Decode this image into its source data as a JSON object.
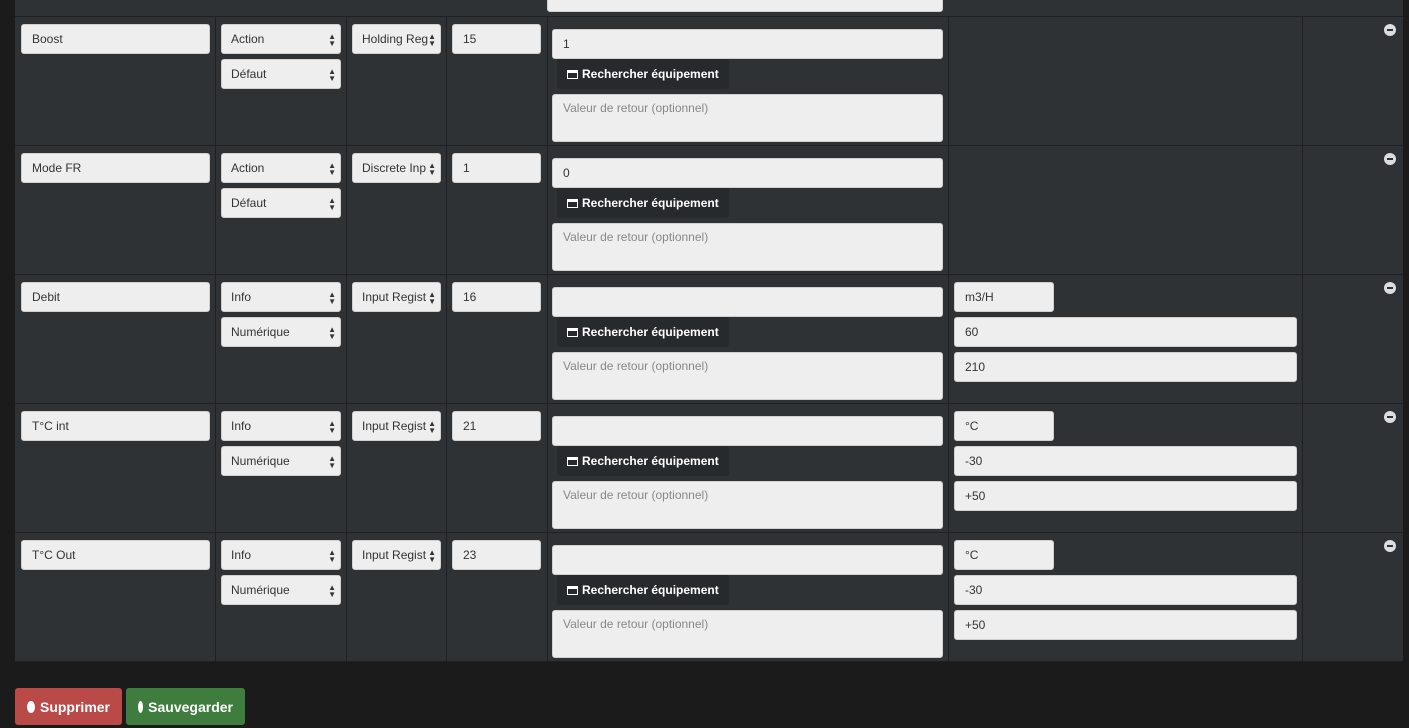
{
  "search_button_label": "Rechercher équipement",
  "return_placeholder": "Valeur de retour (optionnel)",
  "rows": [
    {
      "name": "Boost",
      "type": "Action",
      "subtype": "Défaut",
      "register": "Holding Reg",
      "address": "15",
      "value": "1",
      "unit": "",
      "min": "",
      "max": ""
    },
    {
      "name": "Mode FR",
      "type": "Action",
      "subtype": "Défaut",
      "register": "Discrete Inp",
      "address": "1",
      "value": "0",
      "unit": "",
      "min": "",
      "max": ""
    },
    {
      "name": "Debit",
      "type": "Info",
      "subtype": "Numérique",
      "register": "Input Regist",
      "address": "16",
      "value": "",
      "unit": "m3/H",
      "min": "60",
      "max": "210"
    },
    {
      "name": "T°C int",
      "type": "Info",
      "subtype": "Numérique",
      "register": "Input Regist",
      "address": "21",
      "value": "",
      "unit": "°C",
      "min": "-30",
      "max": "+50"
    },
    {
      "name": "T°C Out",
      "type": "Info",
      "subtype": "Numérique",
      "register": "Input Regist",
      "address": "23",
      "value": "",
      "unit": "°C",
      "min": "-30",
      "max": "+50"
    }
  ],
  "actions": {
    "delete_label": "Supprimer",
    "save_label": "Sauvegarder"
  },
  "colors": {
    "delete": "#b94a48",
    "save": "#3f7d3f"
  }
}
